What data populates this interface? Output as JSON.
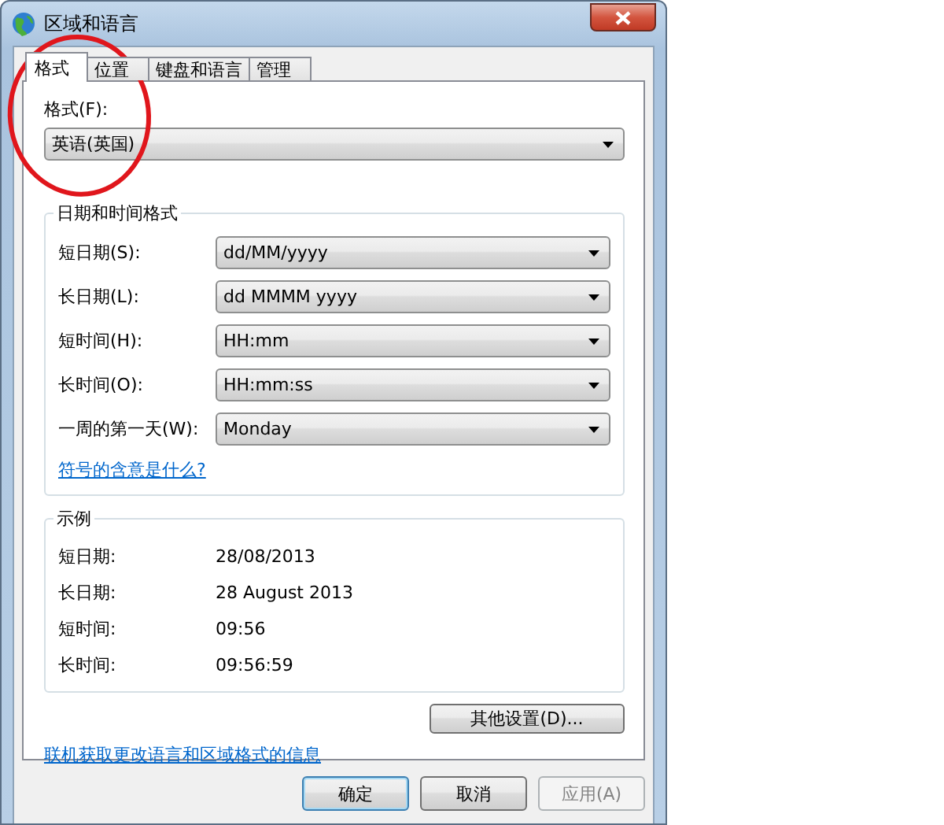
{
  "window": {
    "title": "区域和语言"
  },
  "tabs": [
    {
      "label": "格式",
      "selected": true
    },
    {
      "label": "位置",
      "selected": false
    },
    {
      "label": "键盘和语言",
      "selected": false
    },
    {
      "label": "管理",
      "selected": false
    }
  ],
  "format": {
    "label": "格式(F):",
    "value": "英语(英国)"
  },
  "date_time_formats": {
    "title": "日期和时间格式",
    "rows": [
      {
        "label": "短日期(S):",
        "value": "dd/MM/yyyy"
      },
      {
        "label": "长日期(L):",
        "value": "dd MMMM yyyy"
      },
      {
        "label": "短时间(H):",
        "value": "HH:mm"
      },
      {
        "label": "长时间(O):",
        "value": "HH:mm:ss"
      },
      {
        "label": "一周的第一天(W):",
        "value": "Monday"
      }
    ],
    "link": "符号的含意是什么?"
  },
  "examples": {
    "title": "示例",
    "rows": [
      {
        "label": "短日期:",
        "value": "28/08/2013"
      },
      {
        "label": "长日期:",
        "value": "28 August 2013"
      },
      {
        "label": "短时间:",
        "value": "09:56"
      },
      {
        "label": "长时间:",
        "value": "09:56:59"
      }
    ]
  },
  "additional_button": "其他设置(D)...",
  "online_link": "联机获取更改语言和区域格式的信息",
  "buttons": [
    {
      "label": "确定",
      "disabled": false,
      "default": true
    },
    {
      "label": "取消",
      "disabled": false,
      "default": false
    },
    {
      "label": "应用(A)",
      "disabled": true,
      "default": false
    }
  ],
  "annotation": {
    "kind": "ellipse"
  }
}
